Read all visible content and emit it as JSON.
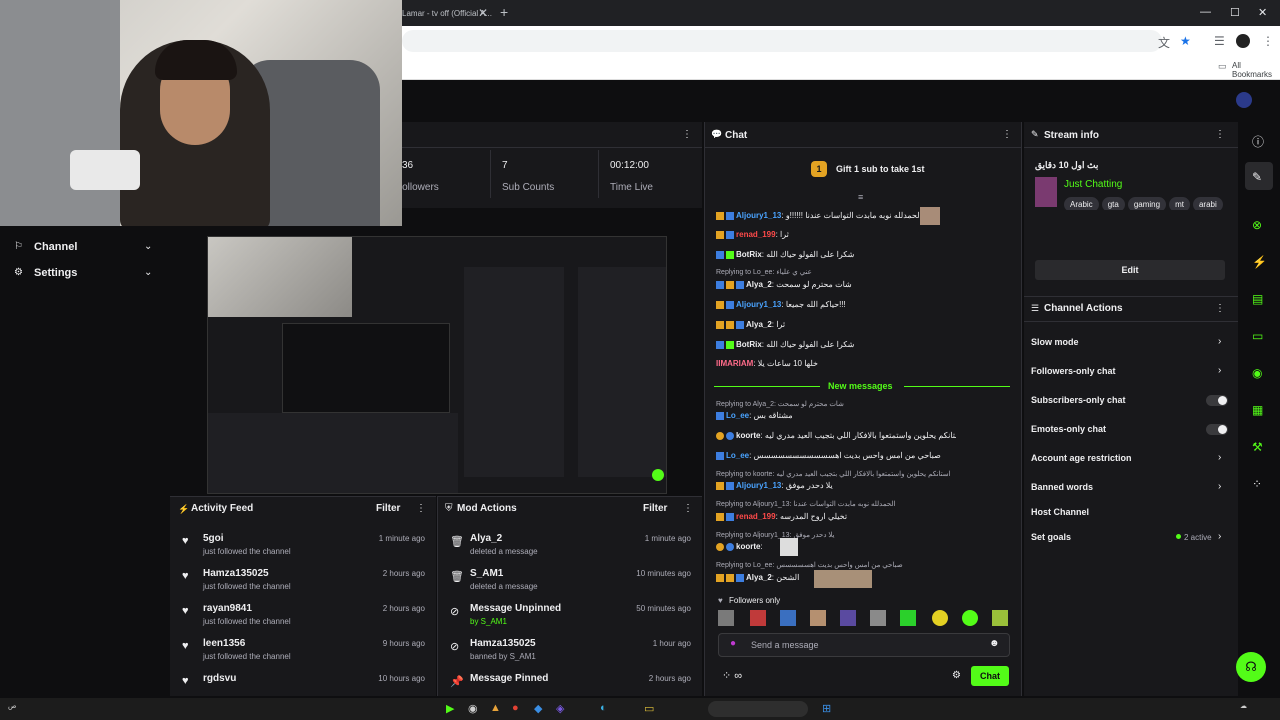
{
  "browser": {
    "tab_title": "Lamar - tv off (Official A...",
    "bookmarks_label": "All Bookmarks"
  },
  "sidebar": {
    "items": [
      {
        "label": "Channel"
      },
      {
        "label": "Settings"
      }
    ]
  },
  "stats": {
    "items": [
      {
        "value": "36",
        "label": "Followers"
      },
      {
        "value": "7",
        "label": "Sub Counts"
      },
      {
        "value": "00:12:00",
        "label": "Time Live"
      }
    ]
  },
  "activity_feed": {
    "title": "Activity Feed",
    "filter_label": "Filter",
    "items": [
      {
        "name": "5goi",
        "sub": "just followed the channel",
        "time": "1 minute ago"
      },
      {
        "name": "Hamza135025",
        "sub": "just followed the channel",
        "time": "2 hours ago"
      },
      {
        "name": "rayan9841",
        "sub": "just followed the channel",
        "time": "2 hours ago"
      },
      {
        "name": "leen1356",
        "sub": "just followed the channel",
        "time": "9 hours ago"
      },
      {
        "name": "rgdsvu",
        "sub": "",
        "time": "10 hours ago"
      }
    ]
  },
  "mod_actions": {
    "title": "Mod Actions",
    "filter_label": "Filter",
    "items": [
      {
        "name": "Alya_2",
        "sub": "deleted a message",
        "time": "1 minute ago"
      },
      {
        "name": "S_AM1",
        "sub": "deleted a message",
        "time": "10 minutes ago"
      },
      {
        "name": "Message Unpinned",
        "sub": "by S_AM1",
        "time": "50 minutes ago"
      },
      {
        "name": "Hamza135025",
        "sub": "banned by S_AM1",
        "time": "1 hour ago"
      },
      {
        "name": "Message Pinned",
        "sub": "",
        "time": "2 hours ago"
      }
    ]
  },
  "chat": {
    "title": "Chat",
    "gift_text": "Gift 1 sub to take 1st",
    "gift_count": "1",
    "new_messages": "New messages",
    "followers_only": "Followers only",
    "input_placeholder": "Send a message",
    "send_label": "Chat",
    "messages": [
      {
        "reply": "",
        "user": "Aljoury1_13",
        "text": ": الحمدلله نوبه مابدت التواسات عندنا !!!!!!و",
        "color": "#4aa3ff"
      },
      {
        "reply": "",
        "user": "renad_199",
        "text": ": ثرا",
        "color": "#ff4a4a"
      },
      {
        "reply": "",
        "user": "BotRix",
        "text": ": شكرا على الفولو حياك الله",
        "color": "#efeff1"
      },
      {
        "reply": "Replying to Lo_ee: عني ي علياء",
        "user": "Alya_2",
        "text": ": شات محترم لو سمحت",
        "color": "#efeff1"
      },
      {
        "reply": "",
        "user": "Aljoury1_13",
        "text": ": حياكم الله جميعا!!!",
        "color": "#4aa3ff"
      },
      {
        "reply": "",
        "user": "Alya_2",
        "text": ": ثرا",
        "color": "#efeff1"
      },
      {
        "reply": "",
        "user": "BotRix",
        "text": ": شكرا على الفولو حياك الله",
        "color": "#efeff1"
      },
      {
        "reply": "",
        "user": "IIMARIAM",
        "text": ": خلها 10 ساعات يلا",
        "color": "#ff6b8a"
      },
      {
        "reply": "Replying to Alya_2: شات محترم لو سمحت",
        "user": "Lo_ee",
        "text": ": مشتاقه بس",
        "color": "#4aa3ff"
      },
      {
        "reply": "",
        "user": "koorte",
        "text": ": استانكم يحلوين واستمتعوا بالافكار اللي بتجيب العيد مدري ليه",
        "color": "#efeff1"
      },
      {
        "reply": "",
        "user": "Lo_ee",
        "text": ": صباحي من امس واحس بديت اهسسسسسسسسسسس",
        "color": "#4aa3ff"
      },
      {
        "reply": "Replying to koorte: استانكم يحلوين واستمتعوا بالافكار اللي بتجيب العيد مدري ليه",
        "user": "Aljoury1_13",
        "text": ": يلا دحدر موفق",
        "color": "#4aa3ff"
      },
      {
        "reply": "Replying to Aljoury1_13: الحمدلله نوبه مابدت التواسات عندنا",
        "user": "renad_199",
        "text": ": تخيلي اروح المدرسه",
        "color": "#ff4a4a"
      },
      {
        "reply": "Replying to Aljoury1_13: يلا دحدر موفق",
        "user": "koorte",
        "text": ":",
        "color": "#efeff1"
      },
      {
        "reply": "Replying to Lo_ee: صباحي من امس واحس بديت اهسسسسس",
        "user": "Alya_2",
        "text": ": الشحن",
        "color": "#efeff1"
      }
    ]
  },
  "stream_info": {
    "title": "Stream info",
    "stream_title": "بث اول 10 دقايق",
    "category": "Just Chatting",
    "tags": [
      "Arabic",
      "gta",
      "gaming",
      "mt",
      "arabi"
    ],
    "edit_label": "Edit"
  },
  "channel_actions": {
    "title": "Channel Actions",
    "items": [
      {
        "label": "Slow mode",
        "kind": "chevron"
      },
      {
        "label": "Followers-only chat",
        "kind": "chevron"
      },
      {
        "label": "Subscribers-only chat",
        "kind": "toggle"
      },
      {
        "label": "Emotes-only chat",
        "kind": "toggle"
      },
      {
        "label": "Account age restriction",
        "kind": "chevron"
      },
      {
        "label": "Banned words",
        "kind": "chevron"
      },
      {
        "label": "Host Channel",
        "kind": "none"
      },
      {
        "label": "Set goals",
        "kind": "chevron"
      }
    ],
    "goals_status": "2 active"
  },
  "colors": {
    "accent": "#53fc18",
    "bg": "#0e0e10",
    "panel": "#18181b"
  }
}
